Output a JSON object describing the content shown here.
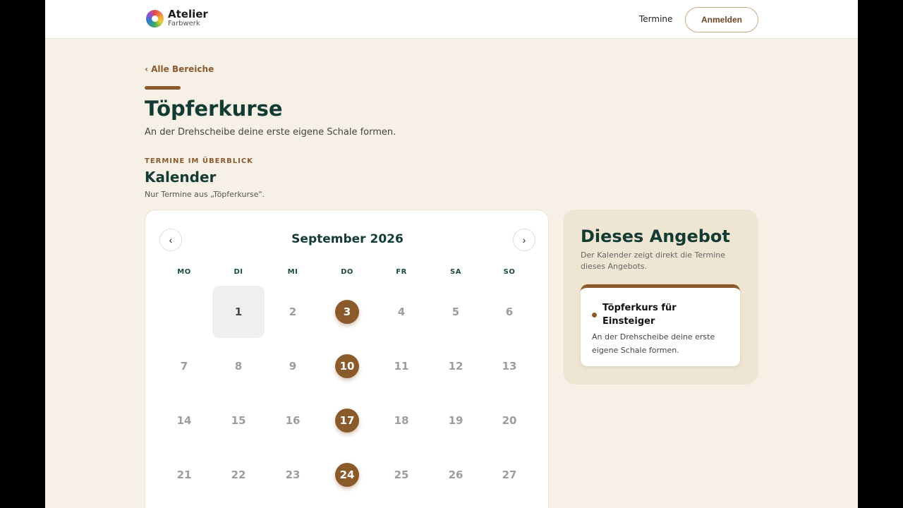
{
  "header": {
    "brand_name": "Atelier",
    "brand_sub": "Farbwerk",
    "nav_termine": "Termine",
    "login_label": "Anmelden"
  },
  "page": {
    "back_link": "‹ Alle Bereiche",
    "title": "Töpferkurse",
    "subtitle": "An der Drehscheibe deine erste eigene Schale formen."
  },
  "calendar_section": {
    "eyebrow": "TERMINE IM ÜBERBLICK",
    "title": "Kalender",
    "note": "Nur Termine aus „Töpferkurse\"."
  },
  "calendar": {
    "month_label": "September 2026",
    "prev_icon": "‹",
    "next_icon": "›",
    "weekdays": [
      "MO",
      "DI",
      "MI",
      "DO",
      "FR",
      "SA",
      "SO"
    ],
    "today": 1,
    "event_days": [
      3,
      10,
      17,
      24
    ],
    "weeks": [
      [
        "",
        "1",
        "2",
        "3",
        "4",
        "5",
        "6"
      ],
      [
        "7",
        "8",
        "9",
        "10",
        "11",
        "12",
        "13"
      ],
      [
        "14",
        "15",
        "16",
        "17",
        "18",
        "19",
        "20"
      ],
      [
        "21",
        "22",
        "23",
        "24",
        "25",
        "26",
        "27"
      ]
    ]
  },
  "aside": {
    "title": "Dieses Angebot",
    "note": "Der Kalender zeigt direkt die Termine dieses Angebots.",
    "offer": {
      "title": "Töpferkurs für Einsteiger",
      "description": "An der Drehscheibe deine erste eigene Schale formen."
    }
  },
  "colors": {
    "accent": "#8b5a2b",
    "heading": "#123b34",
    "background": "#f7f0e6"
  }
}
